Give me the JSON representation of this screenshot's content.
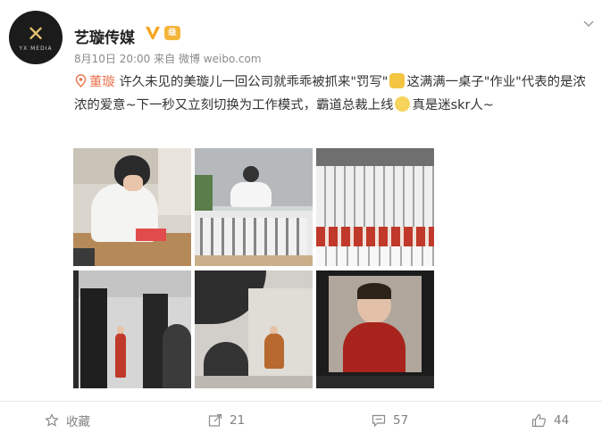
{
  "account": {
    "name": "艺璇传媒",
    "avatar_text": "YX MEDIA",
    "level_badge": "级",
    "verified_icon": "verified-v-icon",
    "colors": {
      "verified": "#f5a623",
      "level": "#f5b53b",
      "avatar_bg": "#1b1b1b"
    }
  },
  "post": {
    "time": "8月10日 20:00",
    "source_prefix": "来自",
    "source": "微博 weibo.com",
    "mention": "董璇",
    "text_part1": "许久未见的美璇儿一回公司就乖乖被抓来\"罚写\"",
    "text_part2": "这满满一桌子\"作业\"代表的是浓浓的爱意~下一秒又立刻切换为工作模式，霸道总裁上线",
    "text_part3": "真是迷skr人~",
    "colors": {
      "mention": "#eb7350",
      "text": "#333333"
    }
  },
  "photos": [
    {
      "name": "photo-signing-at-desk"
    },
    {
      "name": "photo-office-signing"
    },
    {
      "name": "photo-table-of-cards"
    },
    {
      "name": "photo-studio-shoot"
    },
    {
      "name": "photo-photographer-umbrella"
    },
    {
      "name": "photo-monitor-portrait"
    }
  ],
  "actions": {
    "favorite_label": "收藏",
    "repost_count": "21",
    "comment_count": "57",
    "like_count": "44",
    "icons": [
      "star-icon",
      "repost-icon",
      "comment-icon",
      "thumbs-up-icon"
    ]
  }
}
